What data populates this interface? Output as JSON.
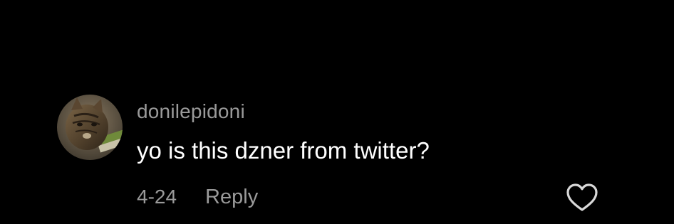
{
  "comment": {
    "avatar_icon": "cat-profile-photo",
    "username": "donilepidoni",
    "text": "yo is this dzner from twitter?",
    "timestamp": "4-24",
    "reply_label": "Reply",
    "like_icon": "heart-outline-icon"
  },
  "colors": {
    "background": "#000000",
    "primary_text": "#ffffff",
    "secondary_text": "#9a9a9a"
  }
}
